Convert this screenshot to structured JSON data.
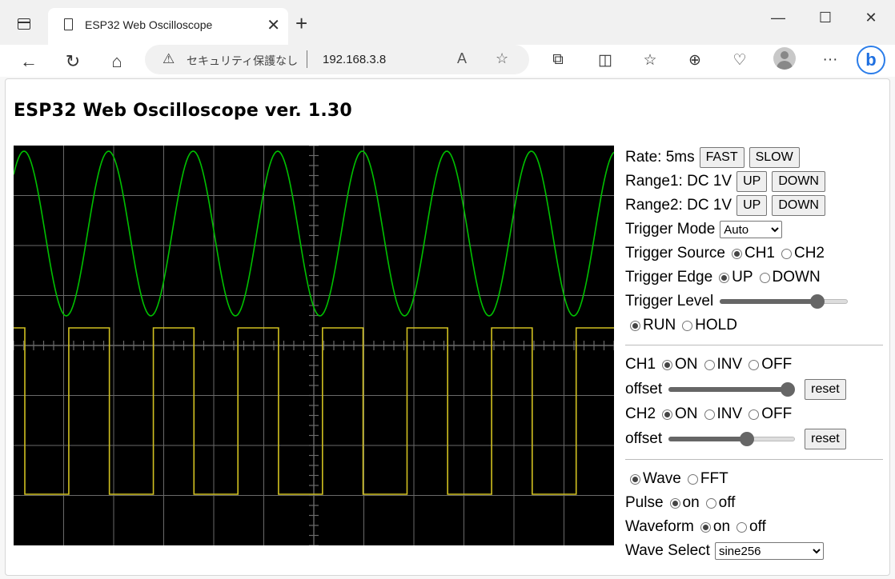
{
  "browser": {
    "tab_title": "ESP32 Web Oscilloscope",
    "new_tab": "+",
    "security_text": "セキュリティ保護なし",
    "url": "192.168.3.8"
  },
  "page": {
    "heading": "ESP32 Web Oscilloscope ver. 1.30"
  },
  "controls": {
    "rate_label": "Rate: 5ms",
    "fast": "FAST",
    "slow": "SLOW",
    "range1_label": "Range1: DC 1V",
    "range2_label": "Range2: DC 1V",
    "up": "UP",
    "down": "DOWN",
    "trigger_mode_label": "Trigger Mode",
    "trigger_mode_value": "Auto",
    "trigger_source_label": "Trigger Source",
    "ch1": "CH1",
    "ch2": "CH2",
    "trigger_edge_label": "Trigger Edge",
    "edge_up": "UP",
    "edge_down": "DOWN",
    "trigger_level_label": "Trigger Level",
    "trigger_level": 0.76,
    "run": "RUN",
    "hold": "HOLD",
    "on": "ON",
    "inv": "INV",
    "off": "OFF",
    "offset_label": "offset",
    "ch1_offset": 1.0,
    "ch2_offset": 0.62,
    "reset": "reset",
    "wave": "Wave",
    "fft": "FFT",
    "pulse_label": "Pulse",
    "waveform_label": "Waveform",
    "on_lc": "on",
    "off_lc": "off",
    "wave_select_label": "Wave Select",
    "wave_select_value": "sine256"
  },
  "colors": {
    "ch1": "#00c000",
    "ch2": "#d0c020",
    "grid": "#6a6a6a"
  }
}
